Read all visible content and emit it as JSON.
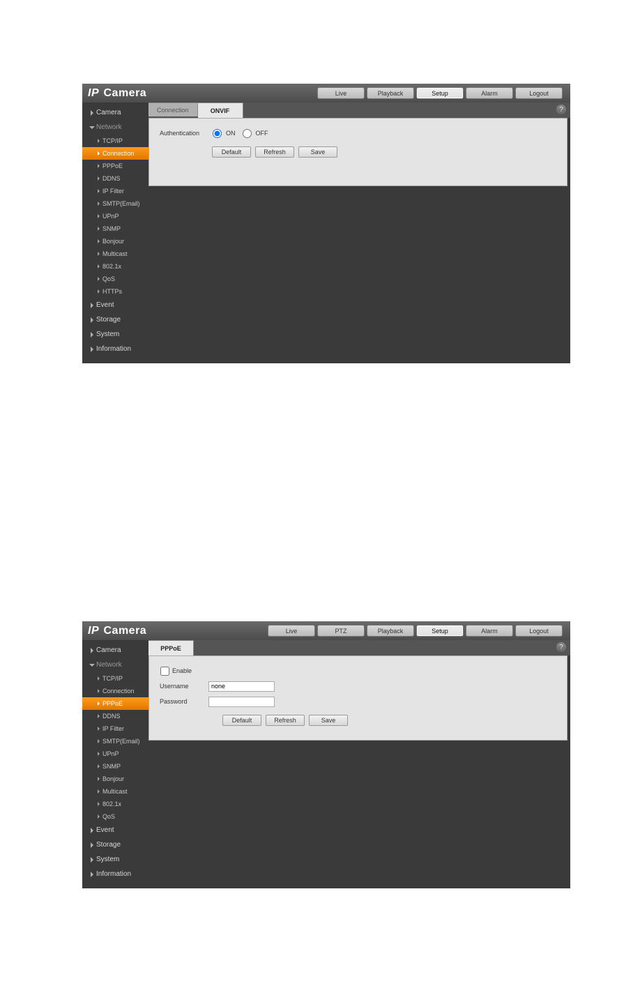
{
  "logo": {
    "prefix": "IP",
    "main": "Camera"
  },
  "topnav1": {
    "items": [
      "Live",
      "Playback",
      "Setup",
      "Alarm",
      "Logout"
    ],
    "active": "Setup"
  },
  "topnav2": {
    "items": [
      "Live",
      "PTZ",
      "Playback",
      "Setup",
      "Alarm",
      "Logout"
    ],
    "active": "Setup"
  },
  "sidebar1": {
    "tops": [
      "Camera",
      "Network",
      "Event",
      "Storage",
      "System",
      "Information"
    ],
    "openTop": "Network",
    "subs": [
      "TCP/IP",
      "Connection",
      "PPPoE",
      "DDNS",
      "IP Filter",
      "SMTP(Email)",
      "UPnP",
      "SNMP",
      "Bonjour",
      "Multicast",
      "802.1x",
      "QoS",
      "HTTPs"
    ],
    "activeSub": "Connection"
  },
  "sidebar2": {
    "tops": [
      "Camera",
      "Network",
      "Event",
      "Storage",
      "System",
      "Information"
    ],
    "openTop": "Network",
    "subs": [
      "TCP/IP",
      "Connection",
      "PPPoE",
      "DDNS",
      "IP Filter",
      "SMTP(Email)",
      "UPnP",
      "SNMP",
      "Bonjour",
      "Multicast",
      "802.1x",
      "QoS"
    ],
    "activeSub": "PPPoE"
  },
  "screen1": {
    "tabs": {
      "items": [
        "Connection",
        "ONVIF"
      ],
      "active": "ONVIF"
    },
    "field_label": "Authentication",
    "radio_on": "ON",
    "radio_off": "OFF",
    "radio_selected": "ON",
    "buttons": {
      "default": "Default",
      "refresh": "Refresh",
      "save": "Save"
    }
  },
  "screen2": {
    "tabs": {
      "items": [
        "PPPoE"
      ],
      "active": "PPPoE"
    },
    "enable_label": "Enable",
    "username_label": "Username",
    "username_value": "none",
    "password_label": "Password",
    "password_value": "",
    "buttons": {
      "default": "Default",
      "refresh": "Refresh",
      "save": "Save"
    }
  },
  "help_glyph": "?"
}
